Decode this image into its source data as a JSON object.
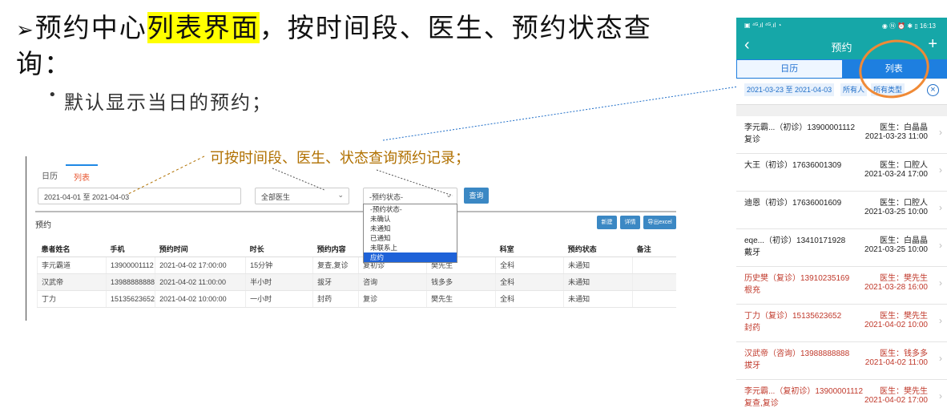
{
  "slide": {
    "title_arrow": "➢",
    "title_pre": "预约中心",
    "title_highlight": "列表界面",
    "title_post": "，按时间段、医生、预约状态查询：",
    "bullet_dot": "•",
    "bullet": "默认显示当日的预约；",
    "callout": "可按时间段、医生、状态查询预约记录；",
    "colors": {
      "highlight": "#ffff00",
      "callout": "#b07000",
      "ring": "#f08a36"
    }
  },
  "desktop": {
    "tabs": [
      "日历",
      "列表"
    ],
    "active_tab": "列表",
    "date_range": "2021-04-01 至 2021-04-03",
    "doctor_select": "全部医生",
    "status_select": "-预约状态-",
    "query_button": "查询",
    "section_title": "预约",
    "actions": [
      "新建",
      "详情",
      "导出excel"
    ],
    "status_options": [
      "-预约状态-",
      "未确认",
      "未通知",
      "已通知",
      "未联系上",
      "应约"
    ],
    "status_highlighted": "应约",
    "columns": [
      "患者姓名",
      "手机",
      "预约时间",
      "时长",
      "预约内容",
      "",
      "",
      "科室",
      "预约状态",
      "备注"
    ],
    "rows": [
      [
        "李元霸道",
        "13900001112",
        "2021-04-02 17:00:00",
        "15分钟",
        "复查,复诊",
        "复初诊",
        "樊先生",
        "全科",
        "未通知",
        ""
      ],
      [
        "汉武帝",
        "13988888888",
        "2021-04-02 11:00:00",
        "半小时",
        "拔牙",
        "咨询",
        "钱多多",
        "全科",
        "未通知",
        ""
      ],
      [
        "丁力",
        "15135623652",
        "2021-04-02 10:00:00",
        "一小时",
        "封药",
        "复诊",
        "樊先生",
        "全科",
        "未通知",
        ""
      ]
    ],
    "colors": {
      "button": "#3b88c4",
      "active_tab": "#e8552f",
      "dropdown_sel": "#1e62d8"
    }
  },
  "phone": {
    "status_left": "▣ ⁴ᴳ.ıl ⁴ᴳ.ıl ◔",
    "status_right": "◉ Ⓝ ⏰ ✱ ▯ 16:13",
    "title": "预约",
    "back_icon": "‹",
    "plus_icon": "+",
    "seg_left": "日历",
    "seg_right": "列表",
    "filter_date": "2021-03-23 至 2021-04-03",
    "filter_person": "所有人",
    "filter_type": "所有类型",
    "items": [
      {
        "line1": "李元霸...（初诊）13900001112",
        "line2": "复诊",
        "doctor": "医生：白晶晶",
        "time": "2021-03-23 11:00",
        "red": false
      },
      {
        "line1": "大王（初诊）17636001309",
        "line2": "",
        "doctor": "医生：口腔人",
        "time": "2021-03-24 17:00",
        "red": false
      },
      {
        "line1": "迪恩（初诊）17636001609",
        "line2": "",
        "doctor": "医生：口腔人",
        "time": "2021-03-25 10:00",
        "red": false
      },
      {
        "line1": "eqe...（初诊）13410171928",
        "line2": "戴牙",
        "doctor": "医生：白晶晶",
        "time": "2021-03-25 10:00",
        "red": false
      },
      {
        "line1": "历史樊（复诊）13910235169",
        "line2": "根充",
        "doctor": "医生：樊先生",
        "time": "2021-03-28 16:00",
        "red": true
      },
      {
        "line1": "丁力（复诊）15135623652",
        "line2": "封药",
        "doctor": "医生：樊先生",
        "time": "2021-04-02 10:00",
        "red": true
      },
      {
        "line1": "汉武帝（咨询）13988888888",
        "line2": "拔牙",
        "doctor": "医生：钱多多",
        "time": "2021-04-02 11:00",
        "red": true
      },
      {
        "line1": "李元霸...（复初诊）13900001112",
        "line2": "复查,复诊",
        "doctor": "医生：樊先生",
        "time": "2021-04-02 17:00",
        "red": true
      }
    ],
    "colors": {
      "header": "#16a7a8",
      "segment": "#1e7fe0",
      "overdue": "#c0392b"
    }
  }
}
